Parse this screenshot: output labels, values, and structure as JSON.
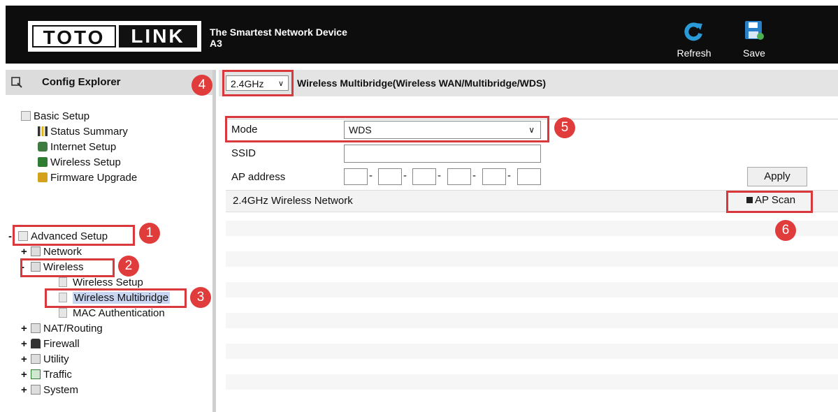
{
  "header": {
    "logo_left": "TOTO",
    "logo_right": "LINK",
    "tagline_line1": "The Smartest Network Device",
    "tagline_line2": "A3",
    "refresh_label": "Refresh",
    "save_label": "Save"
  },
  "sidebar": {
    "title": "Config Explorer",
    "basic_setup": {
      "label": "Basic Setup",
      "items": [
        "Status Summary",
        "Internet Setup",
        "Wireless Setup",
        "Firmware Upgrade"
      ]
    },
    "advanced_setup": {
      "label": "Advanced Setup",
      "network": "Network",
      "wireless": "Wireless",
      "wireless_children": [
        "Wireless Setup",
        "Wireless Multibridge",
        "MAC Authentication"
      ],
      "others": [
        "NAT/Routing",
        "Firewall",
        "Utility",
        "Traffic",
        "System"
      ]
    }
  },
  "main": {
    "band_select_value": "2.4GHz",
    "title": "Wireless Multibridge(Wireless WAN/Multibridge/WDS)",
    "mode_label": "Mode",
    "mode_value": "WDS",
    "ssid_label": "SSID",
    "ssid_value": "",
    "ap_address_label": "AP address",
    "apply_label": "Apply",
    "network_label": "2.4GHz Wireless Network",
    "ap_scan_label": "AP Scan"
  },
  "annotations": [
    "1",
    "2",
    "3",
    "4",
    "5",
    "6"
  ],
  "colors": {
    "accent_red": "#d9383c",
    "header_bg": "#0d0d0d",
    "selected_item": "#c9d6f2"
  }
}
